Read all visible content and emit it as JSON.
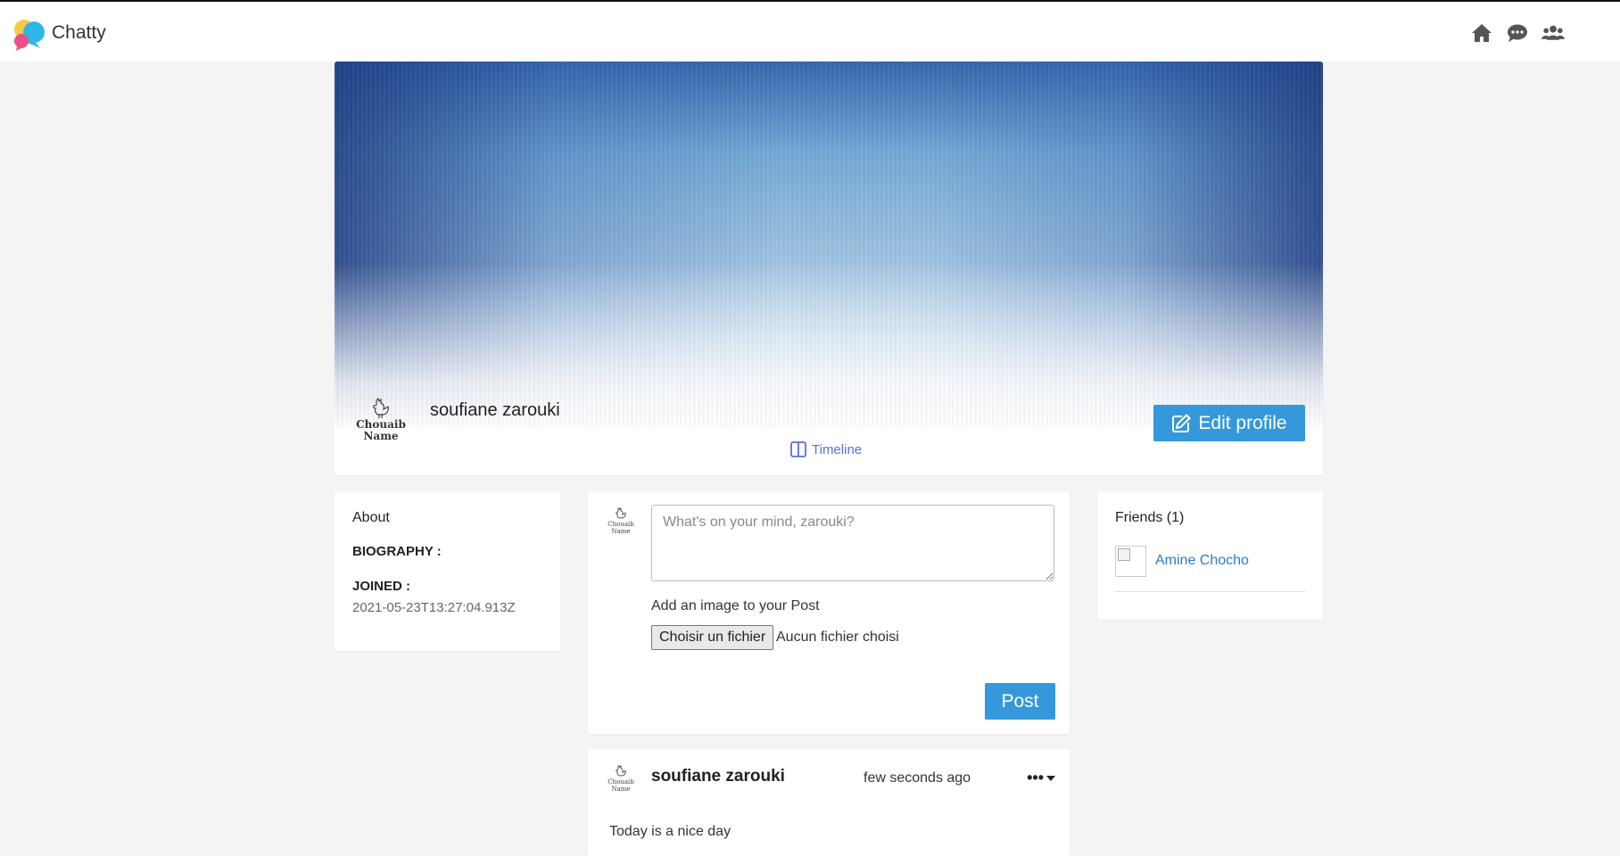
{
  "app": {
    "name": "Chatty"
  },
  "nav": {
    "icons": [
      "home-icon",
      "chat-icon",
      "users-icon"
    ]
  },
  "profile": {
    "name": "soufiane zarouki",
    "avatar_lines": [
      "Chouaib",
      "Name"
    ],
    "edit_label": "Edit profile",
    "tabs": {
      "timeline": "Timeline"
    }
  },
  "about": {
    "title": "About",
    "biography_label": "BIOGRAPHY :",
    "joined_label": "JOINED :",
    "joined_value": "2021-05-23T13:27:04.913Z"
  },
  "composer": {
    "placeholder": "What's on your mind, zarouki?",
    "image_label": "Add an image to your Post",
    "file_button": "Choisir un fichier",
    "file_status": "Aucun fichier choisi",
    "post_label": "Post"
  },
  "post": {
    "author": "soufiane zarouki",
    "time": "few seconds ago",
    "menu": "•••",
    "text": "Today is a nice day"
  },
  "friends": {
    "title": "Friends (1)",
    "list": [
      {
        "name": "Amine Chocho"
      }
    ]
  },
  "colors": {
    "accent": "#3498db",
    "link": "#2a7ec7",
    "tab": "#5b6ee1"
  }
}
